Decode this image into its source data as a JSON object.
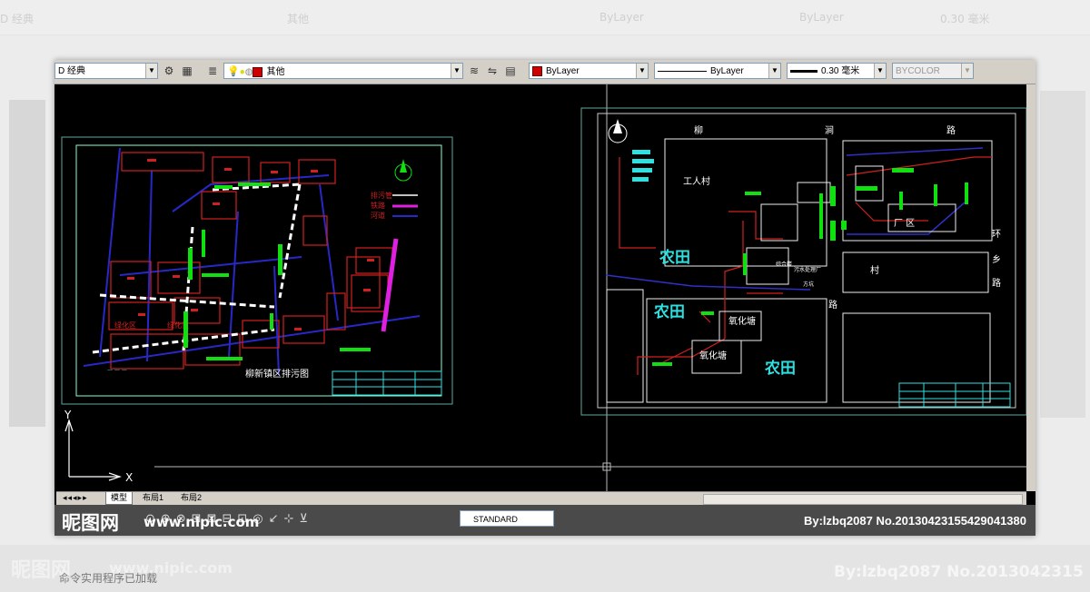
{
  "toolbar": {
    "workspace": "D 经典",
    "layer": "其他",
    "color": "ByLayer",
    "linetype": "ByLayer",
    "lineweight": "0.30 毫米",
    "plotstyle": "BYCOLOR"
  },
  "left_drawing": {
    "title": "柳新镇区排污图",
    "legend": [
      "排污管",
      "铁路",
      "河道"
    ]
  },
  "right_drawing": {
    "road_top": [
      "柳",
      "涧",
      "路"
    ],
    "road_right": [
      "环",
      "乡",
      "路"
    ],
    "road_mid": [
      "路"
    ],
    "village": "工人村",
    "area_factory": "厂 区",
    "village2": "村",
    "fields": [
      "农田",
      "农田",
      "农田"
    ],
    "ponds": [
      "氧化塘",
      "氧化塘"
    ],
    "misc": [
      "综合楼",
      "污水处理厂",
      "方坑"
    ]
  },
  "axes": {
    "x": "X",
    "y": "Y"
  },
  "tabs": [
    {
      "label": "模型"
    },
    {
      "label": "布局1"
    },
    {
      "label": "布局2"
    }
  ],
  "status": {
    "text_style": "STANDARD"
  },
  "watermark": {
    "logo": "昵图网",
    "site": "www.nipic.com",
    "credit": "By:lzbq2087  No.20130423155429041380"
  },
  "background_ghost": {
    "text1": "D 经典",
    "text2": "其他",
    "text3": "ByLayer",
    "text4": "ByLayer",
    "text5": "0.30 毫米",
    "cmd": "命令实用程序已加载",
    "credit2": "By:lzbq2087  No.2013042315"
  },
  "colors": {
    "cad_bg": "#000000",
    "frame": "#5fa7a0",
    "building": "#d02020",
    "road_blue": "#2020c0",
    "green": "#10e010",
    "magenta": "#e020e0",
    "cyan": "#30e0e0"
  }
}
